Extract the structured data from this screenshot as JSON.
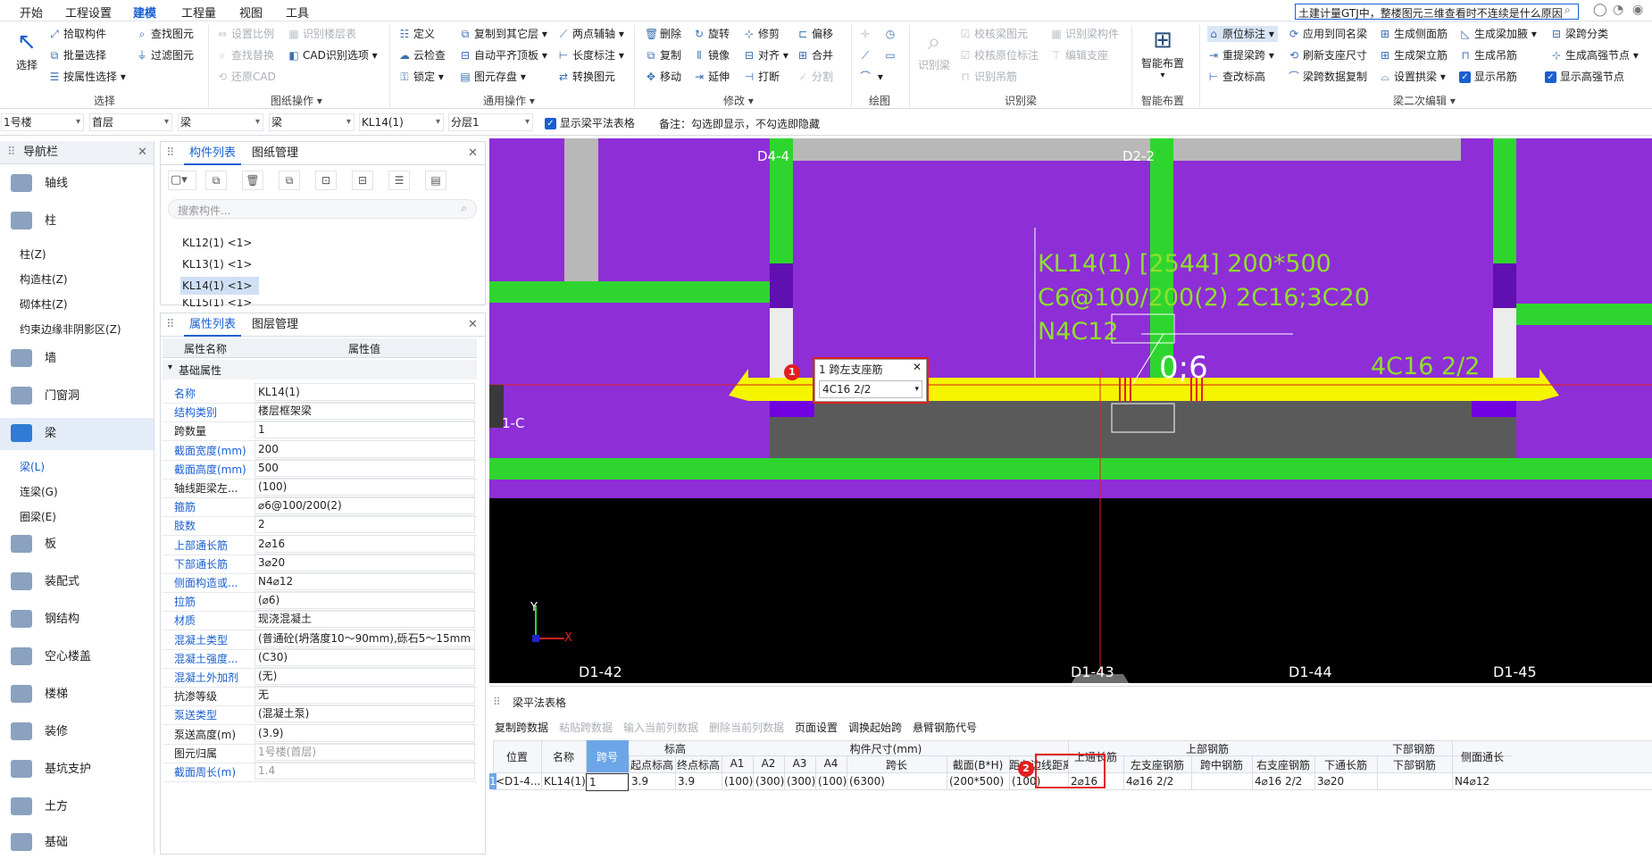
{
  "menu": {
    "items": [
      "开始",
      "工程设置",
      "建模",
      "工程量",
      "视图",
      "工具"
    ],
    "active": "建模"
  },
  "search": {
    "text": "土建计量GTJ中，整楼图元三维查看时不连续是什么原因"
  },
  "ribbon": {
    "select": {
      "label": "选择",
      "items": [
        "拾取构件",
        "批量选择",
        "按属性选择",
        "查找图元",
        "过滤图元"
      ],
      "group": "选择"
    },
    "drawing": {
      "items": [
        "设置比例",
        "查找替换",
        "还原CAD",
        "识别楼层表",
        "CAD识别选项"
      ],
      "group": "图纸操作"
    },
    "general": {
      "items": [
        "定义",
        "云检查",
        "锁定",
        "复制到其它层",
        "自动平齐顶板",
        "图元存盘",
        "两点辅轴",
        "长度标注",
        "转换图元"
      ],
      "group": "通用操作"
    },
    "modify": {
      "items": [
        "删除",
        "旋转",
        "修剪",
        "偏移",
        "复制",
        "镜像",
        "对齐",
        "合并",
        "移动",
        "延伸",
        "打断",
        "分割"
      ],
      "group": "修改"
    },
    "draw": {
      "group": "绘图"
    },
    "recognize": {
      "items": [
        "识别梁",
        "校核梁图元",
        "识别梁构件",
        "校核原位标注",
        "编辑支座",
        "识别吊筋"
      ],
      "group": "识别梁"
    },
    "smart": {
      "label": "智能布置",
      "group": "智能布置"
    },
    "beam2": {
      "items": [
        "原位标注",
        "应用到同名梁",
        "生成侧面筋",
        "生成梁加腋",
        "梁跨分类",
        "重提梁跨",
        "刷新支座尺寸",
        "生成架立筋",
        "生成吊筋",
        "生成高强节点",
        "查改标高",
        "梁跨数据复制",
        "设置拱梁",
        "显示吊筋",
        "显示高强节点"
      ],
      "group": "梁二次编辑"
    }
  },
  "selectors": {
    "floor": "1号楼",
    "level": "首层",
    "type": "梁",
    "subtype": "梁",
    "element": "KL14(1)",
    "layer": "分层1",
    "show_table": "显示梁平法表格",
    "note": "备注：勾选即显示，不勾选即隐藏"
  },
  "nav": {
    "title": "导航栏",
    "items": [
      "轴线",
      "柱",
      "墙",
      "门窗洞",
      "梁",
      "板",
      "装配式",
      "钢结构",
      "空心楼盖",
      "楼梯",
      "装修",
      "基坑支护",
      "土方",
      "基础"
    ],
    "col_subs": [
      "柱(Z)",
      "构造柱(Z)",
      "砌体柱(Z)",
      "约束边缘非阴影区(Z)"
    ],
    "beam_subs": [
      "梁(L)",
      "连梁(G)",
      "圈梁(E)"
    ]
  },
  "components": {
    "tabs": [
      "构件列表",
      "图纸管理"
    ],
    "search_placeholder": "搜索构件...",
    "items": [
      "KL12(1) <1>",
      "KL13(1) <1>",
      "KL14(1) <1>",
      "KL15(1) <1>"
    ]
  },
  "properties": {
    "tabs": [
      "属性列表",
      "图层管理"
    ],
    "header": [
      "属性名称",
      "属性值"
    ],
    "group": "基础属性",
    "rows": [
      {
        "name": "名称",
        "value": "KL14(1)",
        "blue": true
      },
      {
        "name": "结构类别",
        "value": "楼层框架梁",
        "blue": true
      },
      {
        "name": "跨数量",
        "value": "1",
        "blue": false
      },
      {
        "name": "截面宽度(mm)",
        "value": "200",
        "blue": true
      },
      {
        "name": "截面高度(mm)",
        "value": "500",
        "blue": true
      },
      {
        "name": "轴线距梁左...",
        "value": "(100)",
        "blue": false
      },
      {
        "name": "箍筋",
        "value": "⌀6@100/200(2)",
        "blue": true
      },
      {
        "name": "肢数",
        "value": "2",
        "blue": true
      },
      {
        "name": "上部通长筋",
        "value": "2⌀16",
        "blue": true
      },
      {
        "name": "下部通长筋",
        "value": "3⌀20",
        "blue": true
      },
      {
        "name": "侧面构造或...",
        "value": "N4⌀12",
        "blue": true
      },
      {
        "name": "拉筋",
        "value": "(⌀6)",
        "blue": true
      },
      {
        "name": "材质",
        "value": "现浇混凝土",
        "blue": true
      },
      {
        "name": "混凝土类型",
        "value": "(普通砼(坍落度10～90mm),砾石5～15mm ...",
        "blue": true
      },
      {
        "name": "混凝土强度...",
        "value": "(C30)",
        "blue": true
      },
      {
        "name": "混凝土外加剂",
        "value": "(无)",
        "blue": true
      },
      {
        "name": "抗渗等级",
        "value": "无",
        "blue": false
      },
      {
        "name": "泵送类型",
        "value": "(混凝土泵)",
        "blue": true
      },
      {
        "name": "泵送高度(m)",
        "value": "(3.9)",
        "blue": false
      },
      {
        "name": "图元归属",
        "value": "1号楼(首层)",
        "blue": false,
        "gray": true
      },
      {
        "name": "截面周长(m)",
        "value": "1.4",
        "blue": true,
        "gray": true
      }
    ]
  },
  "canvas": {
    "axes_top": [
      "D4-4",
      "D2-2"
    ],
    "axes_bottom": [
      "D1-42",
      "D1-43",
      "D1-44",
      "D1-45"
    ],
    "axis_left": "1-C",
    "beam_text": [
      "KL14(1) [2544] 200*500",
      "C6@100/200(2) 2C16;3C20",
      "N4C12"
    ],
    "support_right": "4C16 2/2",
    "span_value": "0;6",
    "popup_title": "1 跨左支座筋",
    "popup_value": "4C16 2/2",
    "x_label": "X",
    "y_label": "Y",
    "colors": {
      "bg": "#8e2ed6",
      "green": "#2fd52f",
      "yellow": "#f5f500",
      "annot": "#8ee02a"
    }
  },
  "beam_table": {
    "title": "梁平法表格",
    "tools": [
      "复制跨数据",
      "粘贴跨数据",
      "输入当前列数据",
      "删除当前列数据",
      "页面设置",
      "调换起始跨",
      "悬臂钢筋代号"
    ],
    "groups": {
      "elev": "标高",
      "size": "构件尺寸(mm)",
      "top": "上部钢筋",
      "bottom": "下部钢筋"
    },
    "headers": [
      "位置",
      "名称",
      "跨号",
      "起点标高",
      "终点标高",
      "A1",
      "A2",
      "A3",
      "A4",
      "跨长",
      "截面(B*H)",
      "距左边线距离",
      "上通长筋",
      "左支座钢筋",
      "跨中钢筋",
      "右支座钢筋",
      "下通长筋",
      "下部钢筋",
      "侧面通长"
    ],
    "row": [
      "<D1-4...",
      "KL14(1)",
      "1",
      "3.9",
      "3.9",
      "(100)",
      "(300)",
      "(300)",
      "(100)",
      "(6300)",
      "(200*500)",
      "(100)",
      "2⌀16",
      "4⌀16 2/2",
      "",
      "4⌀16 2/2",
      "3⌀20",
      "",
      "N4⌀12"
    ],
    "row_num": "1"
  },
  "markers": [
    "1",
    "2"
  ]
}
